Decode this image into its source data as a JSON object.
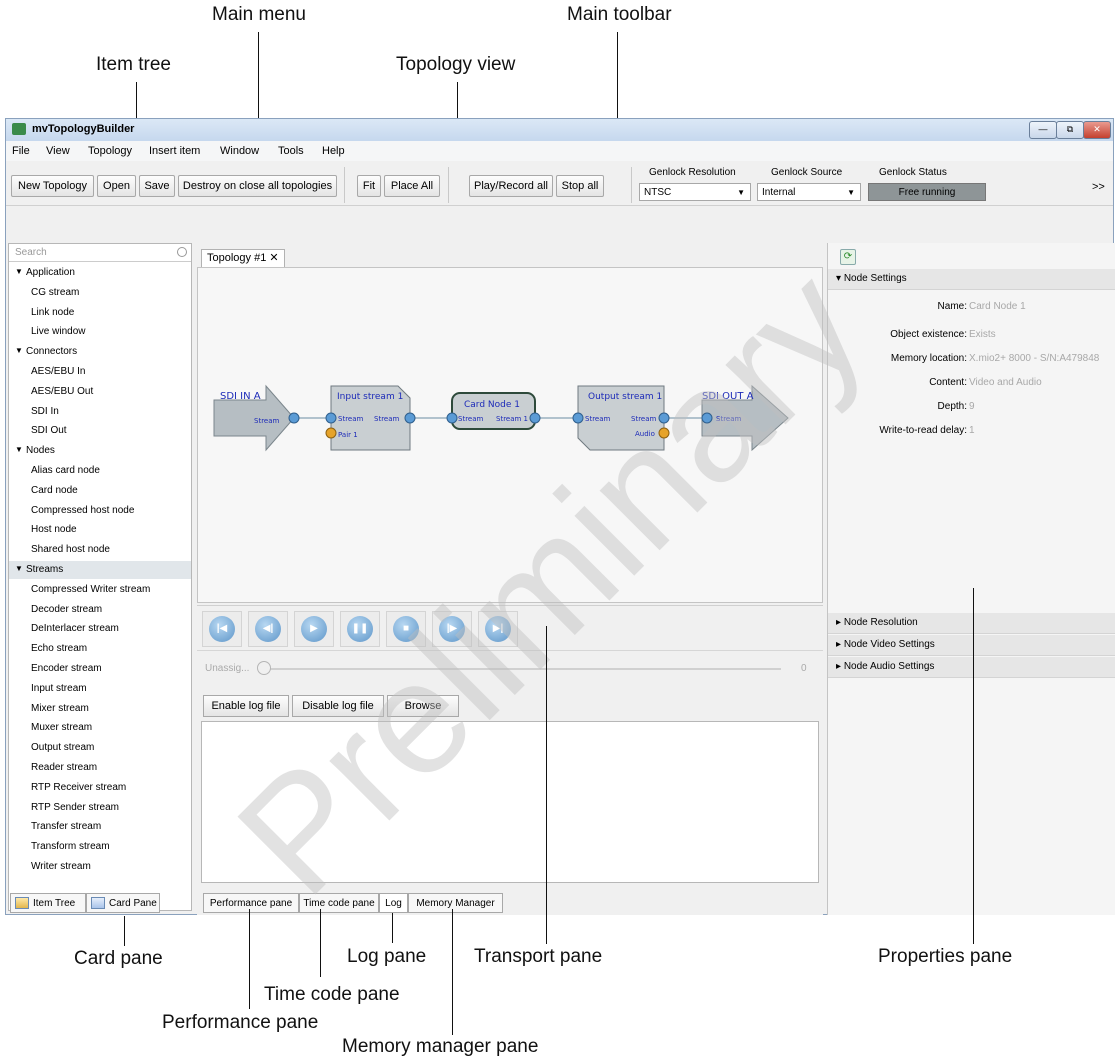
{
  "callouts": {
    "main_menu": "Main menu",
    "main_toolbar": "Main toolbar",
    "item_tree": "Item tree",
    "topology_view": "Topology view",
    "card_pane": "Card pane",
    "log_pane": "Log pane",
    "transport_pane": "Transport pane",
    "properties_pane": "Properties pane",
    "time_code_pane": "Time code pane",
    "performance_pane": "Performance pane",
    "memory_manager_pane": "Memory manager pane"
  },
  "window": {
    "title": "mvTopologyBuilder",
    "controls": {
      "minimize": "—",
      "restore": "⧉",
      "close": "✕"
    }
  },
  "menu": [
    "File",
    "View",
    "Topology",
    "Insert item",
    "Window",
    "Tools",
    "Help"
  ],
  "toolbar": {
    "buttons": [
      "New Topology",
      "Open",
      "Save",
      "Destroy on close all topologies",
      "Fit",
      "Place All",
      "Play/Record all",
      "Stop all"
    ],
    "genlock_resolution_label": "Genlock Resolution",
    "genlock_resolution_value": "NTSC",
    "genlock_source_label": "Genlock Source",
    "genlock_source_value": "Internal",
    "genlock_status_label": "Genlock Status",
    "genlock_status_value": "Free running",
    "overflow": ">>"
  },
  "item_tree": {
    "search_placeholder": "Search",
    "groups": [
      {
        "name": "Application",
        "items": [
          "CG stream",
          "Link node",
          "Live window"
        ]
      },
      {
        "name": "Connectors",
        "items": [
          "AES/EBU In",
          "AES/EBU Out",
          "SDI In",
          "SDI Out"
        ]
      },
      {
        "name": "Nodes",
        "items": [
          "Alias card node",
          "Card node",
          "Compressed host node",
          "Host node",
          "Shared host node"
        ]
      },
      {
        "name": "Streams",
        "items": [
          "Compressed Writer stream",
          "Decoder stream",
          "DeInterlacer stream",
          "Echo stream",
          "Encoder stream",
          "Input stream",
          "Mixer stream",
          "Muxer stream",
          "Output stream",
          "Reader stream",
          "RTP Receiver stream",
          "RTP Sender stream",
          "Transfer stream",
          "Transform stream",
          "Writer stream"
        ]
      }
    ],
    "tabs": [
      "Item Tree",
      "Card Pane"
    ]
  },
  "topology": {
    "tab_label": "Topology #1",
    "tab_close": "✕",
    "nodes": {
      "sdi_in": {
        "title": "SDI IN A",
        "port": "Stream"
      },
      "input_stream": {
        "title": "Input stream 1",
        "in_port": "Stream",
        "out_port": "Stream",
        "pair_port": "Pair 1"
      },
      "card_node": {
        "title": "Card Node 1",
        "in_port": "Stream",
        "out_port": "Stream 1"
      },
      "output_stream": {
        "title": "Output stream 1",
        "in_port": "Stream",
        "out_port": "Stream",
        "audio_port": "Audio"
      },
      "sdi_out": {
        "title": "SDI OUT A",
        "port": "Stream"
      }
    }
  },
  "transport": {
    "buttons": [
      "skip-start",
      "step-back",
      "play",
      "pause",
      "stop",
      "step-forward",
      "skip-end"
    ],
    "slider_label": "Unassig...",
    "slider_value": "0"
  },
  "log": {
    "buttons": [
      "Enable log file",
      "Disable log file",
      "Browse"
    ]
  },
  "bottom_tabs": [
    "Performance pane",
    "Time code pane",
    "Log",
    "Memory Manager"
  ],
  "properties": {
    "sections": [
      "Node Settings",
      "Node Resolution",
      "Node Video Settings",
      "Node Audio Settings"
    ],
    "fields": [
      {
        "label": "Name:",
        "value": "Card Node 1"
      },
      {
        "label": "Object existence:",
        "value": "Exists"
      },
      {
        "label": "Memory location:",
        "value": "X.mio2+ 8000 - S/N:A479848"
      },
      {
        "label": "Content:",
        "value": "Video and Audio"
      },
      {
        "label": "Depth:",
        "value": "9"
      },
      {
        "label": "Write-to-read delay:",
        "value": "1"
      }
    ]
  },
  "watermark": "Preliminary",
  "colors": {
    "accent": "#5d95c8",
    "port_blue": "#5b9bd5",
    "port_orange": "#e6a32a",
    "node_fill": "#cfd4d6"
  }
}
